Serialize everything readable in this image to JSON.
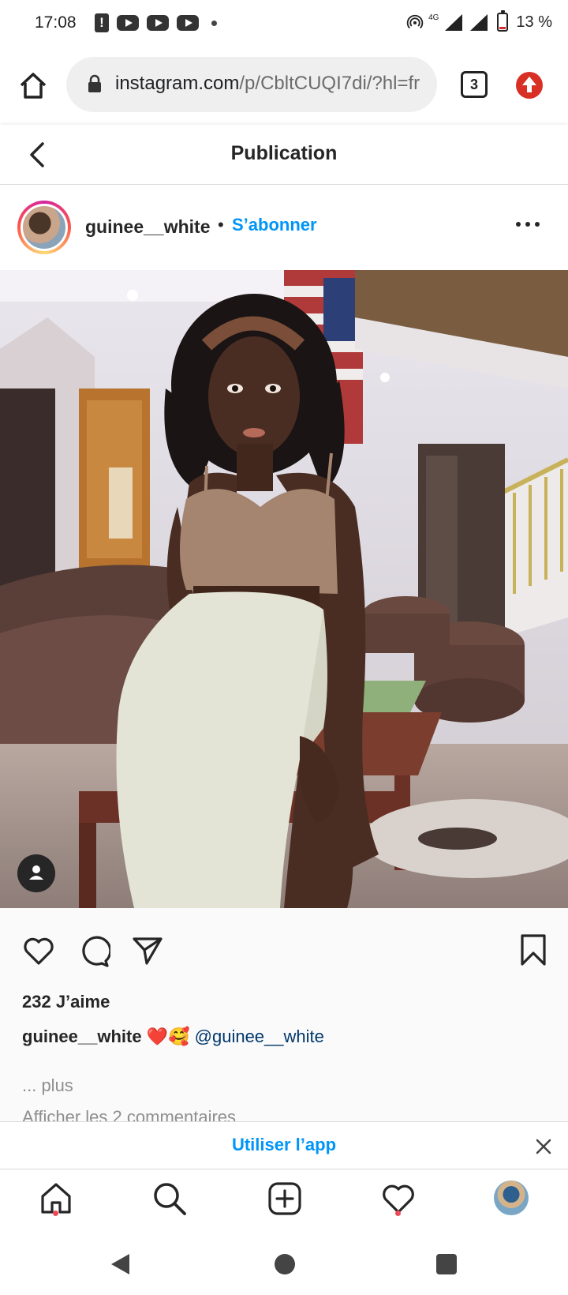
{
  "status_bar": {
    "time": "17:08",
    "network": "4G",
    "battery": "13 %",
    "icons": [
      "warning-icon",
      "youtube-icon",
      "youtube-icon",
      "youtube-icon",
      "dot-icon",
      "hotspot-icon",
      "signal-icon",
      "battery-icon"
    ]
  },
  "browser": {
    "url_host": "instagram.com",
    "url_path": "/p/CbltCUQI7di/?hl=fr",
    "tab_count": "3"
  },
  "header": {
    "title": "Publication"
  },
  "post": {
    "username": "guinee__white",
    "separator": "•",
    "follow_label": "S’abonner",
    "likes": "232 J’aime",
    "caption_user": "guinee__white",
    "caption_emoji": "❤️🥰",
    "caption_mention": "@guinee__white",
    "more_label": "... plus",
    "view_comments": "Afficher les 2 commentaires"
  },
  "app_banner": {
    "label": "Utiliser l’app"
  },
  "colors": {
    "accent": "#0095f6",
    "mention": "#00376b",
    "notification": "#ed4956",
    "browser_update": "#d93025"
  }
}
